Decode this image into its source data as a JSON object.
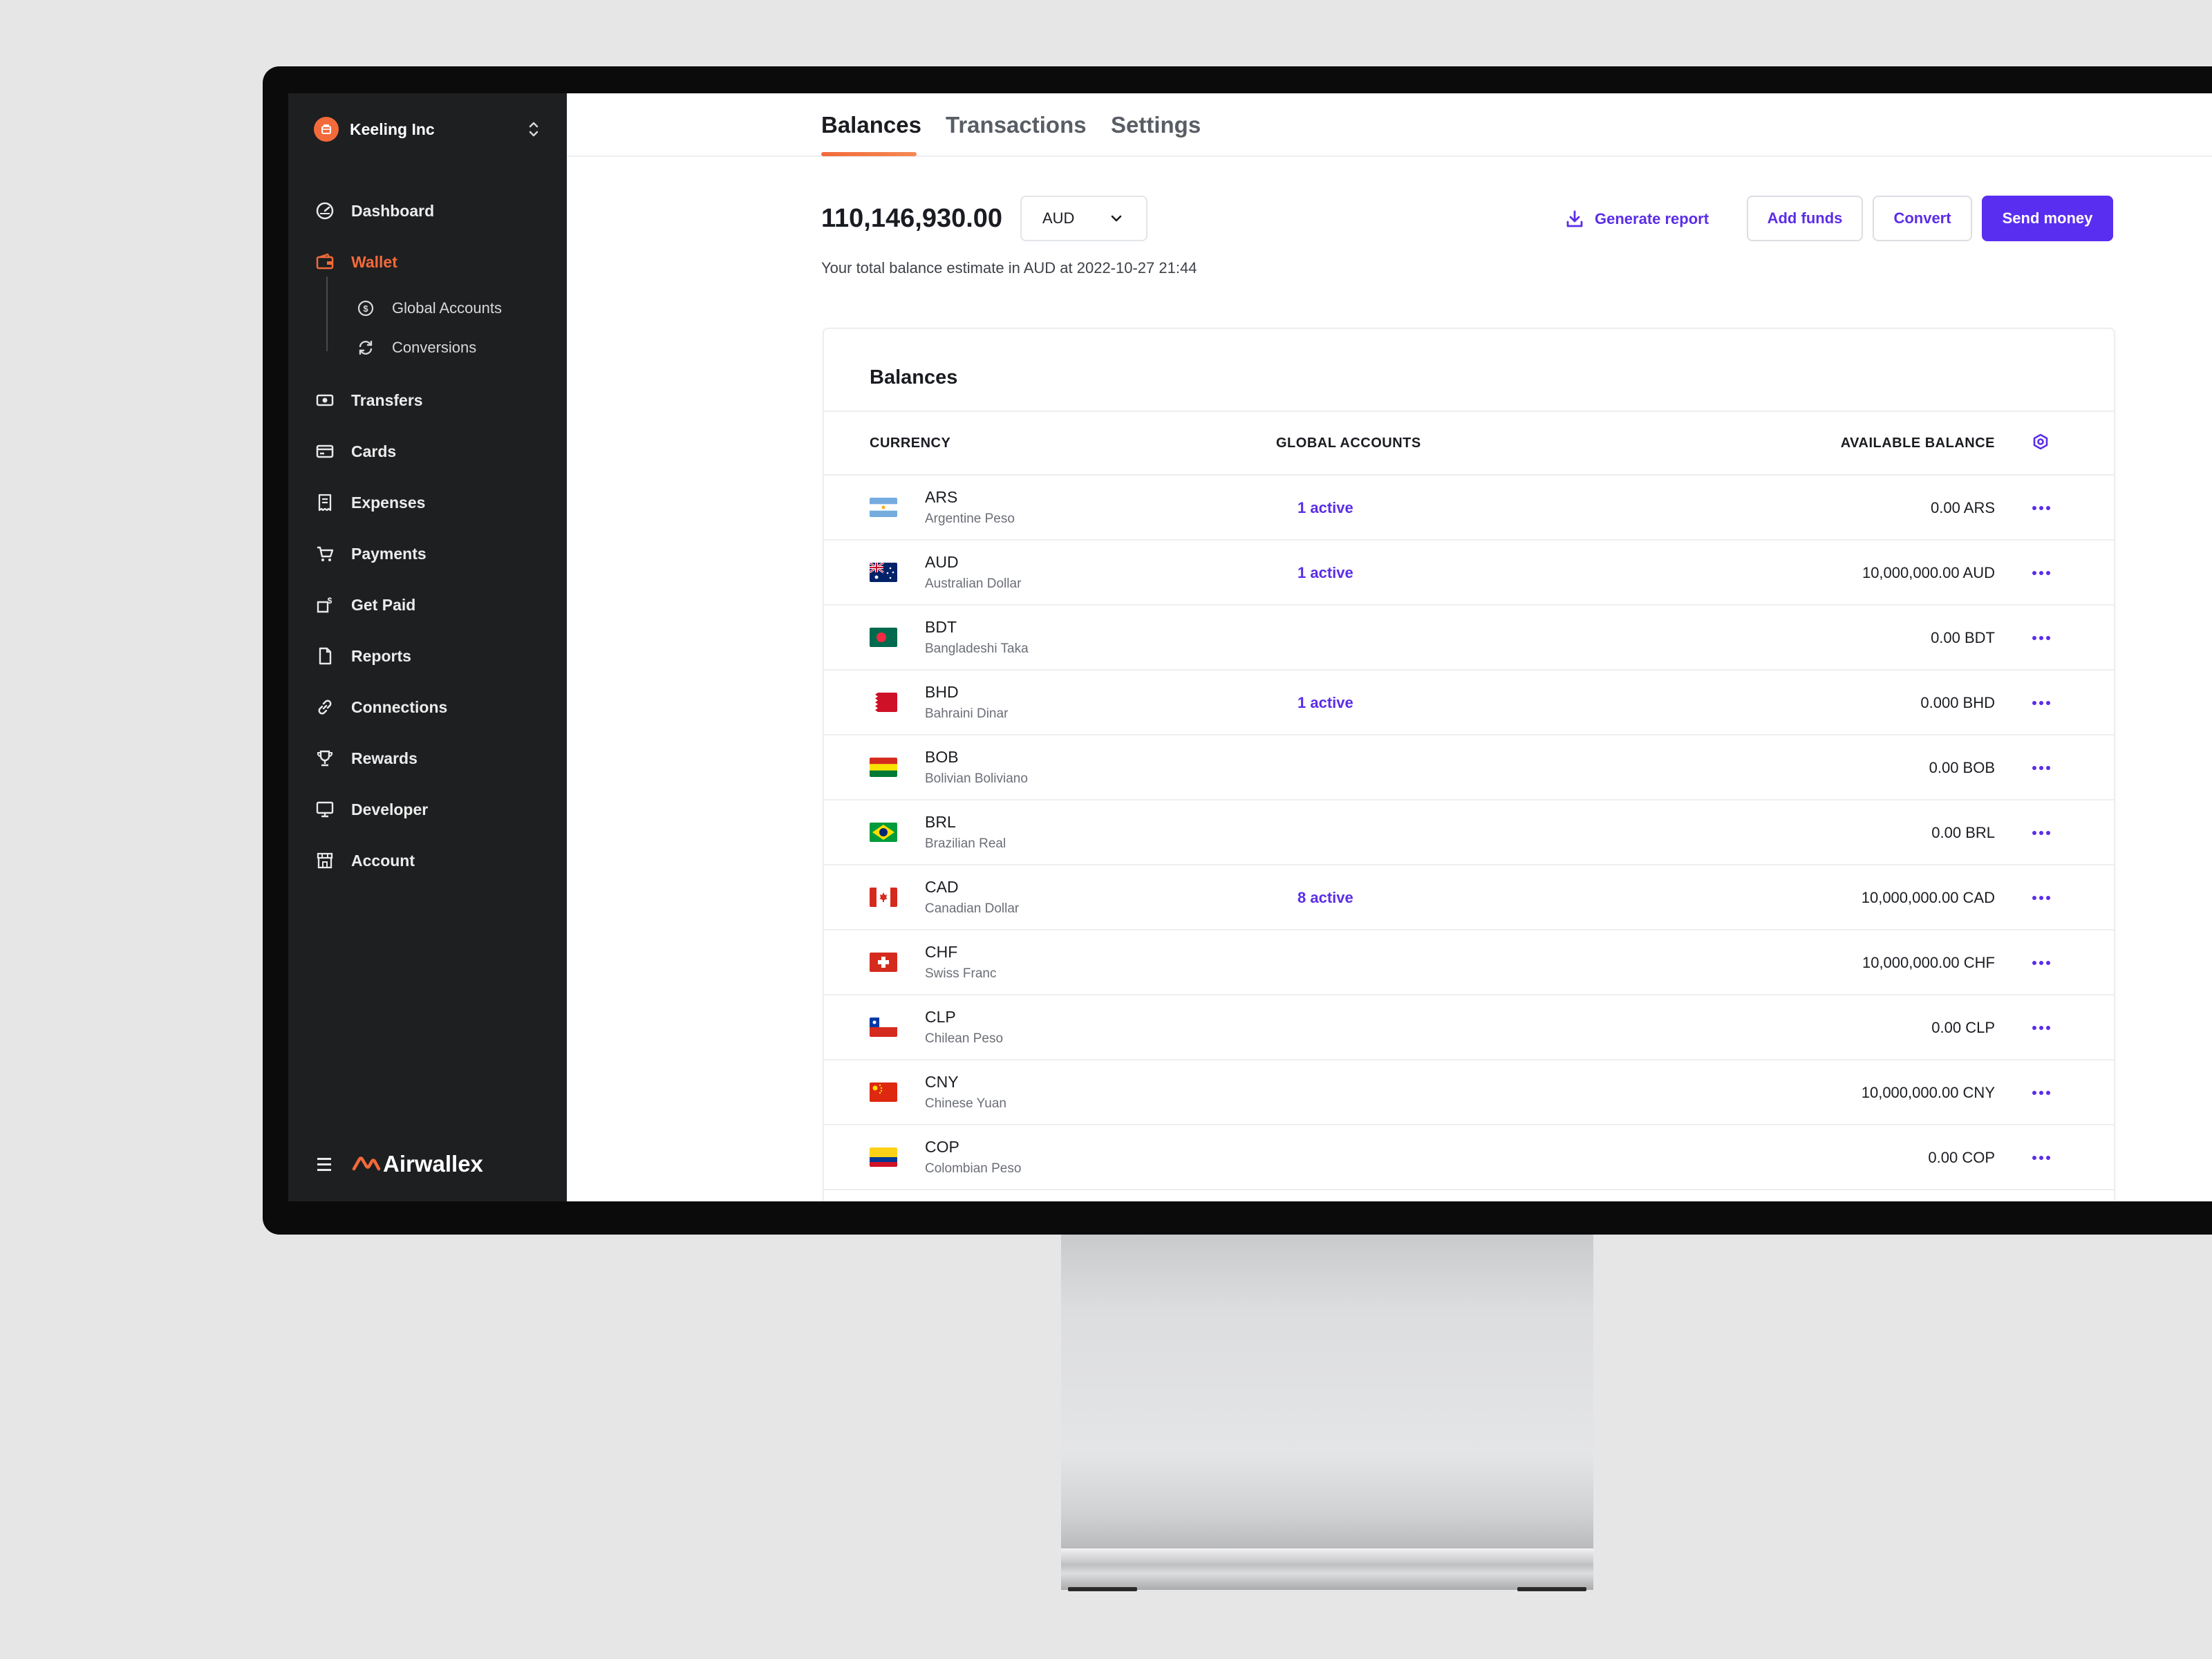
{
  "sidebar": {
    "org_name": "Keeling Inc",
    "items": [
      {
        "label": "Dashboard",
        "icon": "dashboard-icon"
      },
      {
        "label": "Wallet",
        "icon": "wallet-icon",
        "active": true
      },
      {
        "label": "Transfers",
        "icon": "transfers-icon"
      },
      {
        "label": "Cards",
        "icon": "card-icon"
      },
      {
        "label": "Expenses",
        "icon": "receipt-icon"
      },
      {
        "label": "Payments",
        "icon": "cart-icon"
      },
      {
        "label": "Get Paid",
        "icon": "get-paid-icon"
      },
      {
        "label": "Reports",
        "icon": "document-icon"
      },
      {
        "label": "Connections",
        "icon": "link-icon"
      },
      {
        "label": "Rewards",
        "icon": "trophy-icon"
      },
      {
        "label": "Developer",
        "icon": "monitor-icon"
      },
      {
        "label": "Account",
        "icon": "store-icon"
      }
    ],
    "subitems": [
      {
        "label": "Global Accounts",
        "icon": "dollar-circle-icon"
      },
      {
        "label": "Conversions",
        "icon": "refresh-icon"
      }
    ],
    "brand": "Airwallex"
  },
  "tabs": [
    "Balances",
    "Transactions",
    "Settings"
  ],
  "summary": {
    "total": "110,146,930.00",
    "currency": "AUD",
    "caption": "Your total balance estimate in AUD at 2022-10-27 21:44"
  },
  "actions": {
    "generate_report": "Generate report",
    "add_funds": "Add funds",
    "convert": "Convert",
    "send_money": "Send money"
  },
  "balances": {
    "title": "Balances",
    "columns": [
      "CURRENCY",
      "GLOBAL ACCOUNTS",
      "AVAILABLE BALANCE"
    ],
    "rows": [
      {
        "code": "ARS",
        "name": "Argentine Peso",
        "accounts": "1 active",
        "balance": "0.00 ARS"
      },
      {
        "code": "AUD",
        "name": "Australian Dollar",
        "accounts": "1 active",
        "balance": "10,000,000.00 AUD"
      },
      {
        "code": "BDT",
        "name": "Bangladeshi Taka",
        "accounts": "",
        "balance": "0.00 BDT"
      },
      {
        "code": "BHD",
        "name": "Bahraini Dinar",
        "accounts": "1 active",
        "balance": "0.000 BHD"
      },
      {
        "code": "BOB",
        "name": "Bolivian Boliviano",
        "accounts": "",
        "balance": "0.00 BOB"
      },
      {
        "code": "BRL",
        "name": "Brazilian Real",
        "accounts": "",
        "balance": "0.00 BRL"
      },
      {
        "code": "CAD",
        "name": "Canadian Dollar",
        "accounts": "8 active",
        "balance": "10,000,000.00 CAD"
      },
      {
        "code": "CHF",
        "name": "Swiss Franc",
        "accounts": "",
        "balance": "10,000,000.00 CHF"
      },
      {
        "code": "CLP",
        "name": "Chilean Peso",
        "accounts": "",
        "balance": "0.00 CLP"
      },
      {
        "code": "CNY",
        "name": "Chinese Yuan",
        "accounts": "",
        "balance": "10,000,000.00 CNY"
      },
      {
        "code": "COP",
        "name": "Colombian Peso",
        "accounts": "",
        "balance": "0.00 COP"
      }
    ]
  },
  "colors": {
    "accent": "#5b2de8",
    "brand_orange": "#f26a3a",
    "sidebar_bg": "#1e1f21"
  }
}
